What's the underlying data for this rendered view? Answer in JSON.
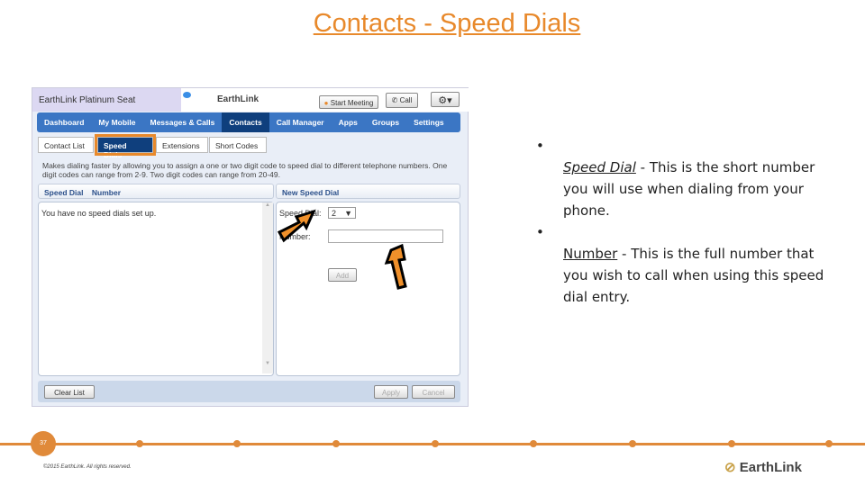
{
  "title": "Contacts - Speed Dials",
  "app": {
    "seat": "EarthLink Platinum Seat",
    "logo": "EarthLink",
    "start_meeting": "Start Meeting",
    "call": "Call",
    "nav": [
      "Dashboard",
      "My Mobile",
      "Messages & Calls",
      "Contacts",
      "Call Manager",
      "Apps",
      "Groups",
      "Settings"
    ],
    "active_nav": "Contacts",
    "tabs": [
      "Contact List",
      "Speed Dials",
      "Extensions",
      "Short Codes"
    ],
    "active_tab": "Speed Dials",
    "description": "Makes dialing faster by allowing you to assign a one or two digit code to speed dial to different telephone numbers. One digit codes can range from 2-9. Two digit codes can range from 20-49.",
    "list_headers": [
      "Speed Dial",
      "Number"
    ],
    "empty_message": "You have no speed dials set up.",
    "new_header": "New Speed Dial",
    "speed_dial_label": "Speed Dial:",
    "speed_dial_value": "2",
    "number_label": "Number:",
    "number_value": "",
    "add": "Add",
    "clear_list": "Clear List",
    "apply": "Apply",
    "cancel": "Cancel"
  },
  "bullets": [
    {
      "term": "Speed Dial",
      "text": " - This is the short number you will use when dialing from your phone."
    },
    {
      "term": "Number",
      "text": " - This is the full number that you wish to call when using this speed dial entry."
    }
  ],
  "footer": {
    "page": "37",
    "copyright": "©2015 EarthLink. All rights reserved.",
    "logo": "EarthLink"
  },
  "colors": {
    "accent": "#e8892b",
    "nav": "#3b76c4",
    "nav_active": "#0f3f7d"
  }
}
